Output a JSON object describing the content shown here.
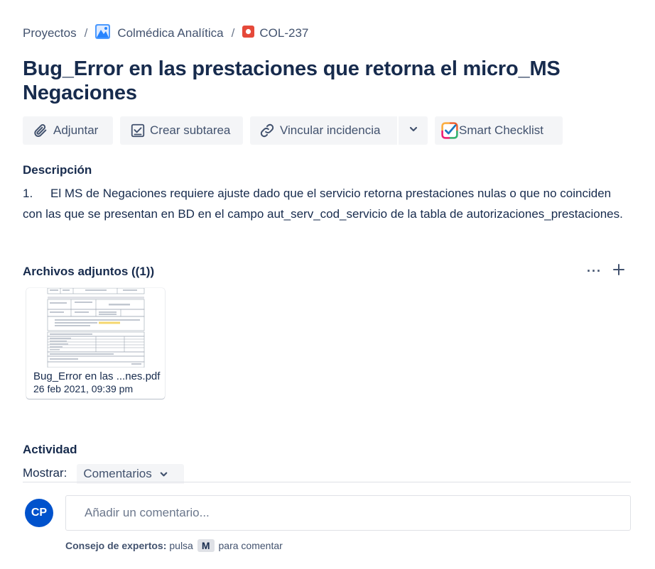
{
  "breadcrumb": {
    "items": [
      "Proyectos",
      "Colmédica Analítica",
      "COL-237"
    ],
    "separator": "/",
    "project_icon": "project-mountain-icon",
    "issue_icon": "bug-icon",
    "bug_color": "#e5493a"
  },
  "issue": {
    "title": "Bug_Error en las prestaciones que retorna el micro_MS Negaciones"
  },
  "toolbar": {
    "attach_label": "Adjuntar",
    "subtask_label": "Crear subtarea",
    "link_label": "Vincular incidencia",
    "checklist_label": "Smart Checklist"
  },
  "description": {
    "label": "Descripción",
    "number": "1.",
    "text": "El MS de Negaciones requiere ajuste dado que el servicio retorna prestaciones nulas o que no coinciden con las que se presentan en BD en el campo aut_serv_cod_servicio de la tabla de autorizaciones_prestaciones."
  },
  "attachments": {
    "label": "Archivos adjuntos ((1))",
    "more_label": "···",
    "files": [
      {
        "name": "Bug_Error en las ...nes.pdf",
        "date": "26 feb 2021, 09:39 pm"
      }
    ]
  },
  "activity": {
    "label": "Actividad",
    "show_label": "Mostrar:",
    "filter_value": "Comentarios",
    "avatar_initials": "CP",
    "avatar_color": "#0052cc",
    "comment_placeholder": "Añadir un comentario...",
    "tip_bold": "Consejo de expertos:",
    "tip_before": "pulsa",
    "tip_key": "M",
    "tip_after": "para comentar"
  }
}
